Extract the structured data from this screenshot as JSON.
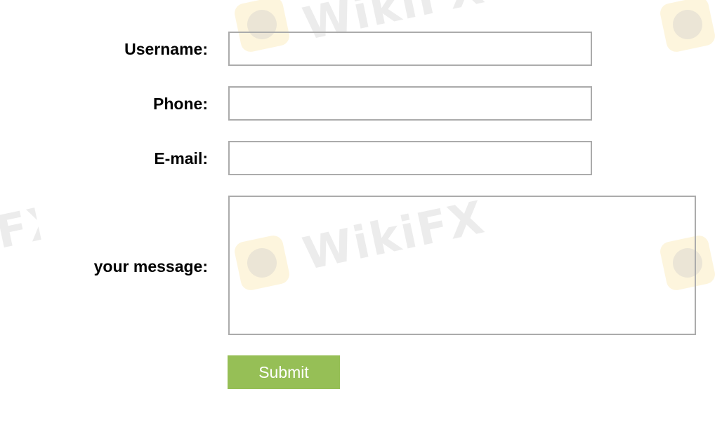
{
  "watermark": {
    "brand_text": "WikiFX"
  },
  "form": {
    "username": {
      "label": "Username:",
      "value": "",
      "placeholder": ""
    },
    "phone": {
      "label": "Phone:",
      "value": "",
      "placeholder": ""
    },
    "email": {
      "label": "E-mail:",
      "value": "",
      "placeholder": ""
    },
    "message": {
      "label": "your message:",
      "value": "",
      "placeholder": ""
    },
    "submit_label": "Submit"
  },
  "colors": {
    "submit_bg": "#96bf56",
    "field_border": "#ababab"
  }
}
